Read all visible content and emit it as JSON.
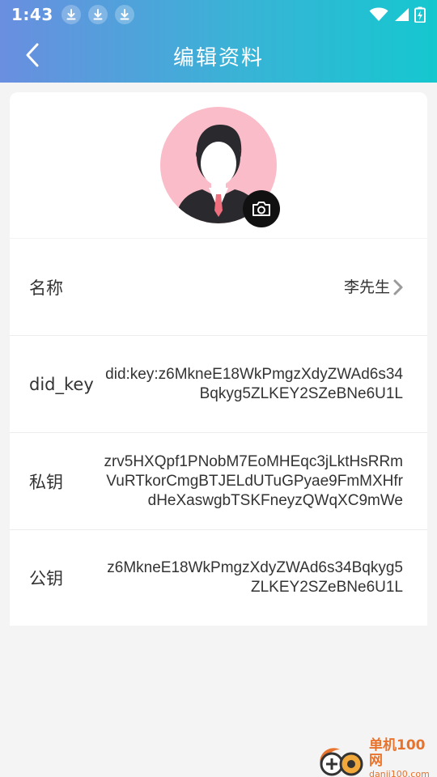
{
  "status_bar": {
    "time": "1:43",
    "download_icons": [
      "download-icon",
      "download-icon",
      "download-icon"
    ],
    "system_icons": [
      "wifi-icon",
      "signal-icon",
      "battery-charging-icon"
    ]
  },
  "header": {
    "title": "编辑资料",
    "back_icon": "chevron-left-icon"
  },
  "profile": {
    "avatar_icon": "person-avatar-icon",
    "camera_icon": "camera-icon"
  },
  "fields": [
    {
      "label": "名称",
      "value": "李先生",
      "has_arrow": true
    },
    {
      "label": "did_key",
      "value": "did:key:z6MkneE18WkPmgzXdyZWAd6s34Bqkyg5ZLKEY2SZeBNe6U1L"
    },
    {
      "label": "私钥",
      "value": "zrv5HXQpf1PNobM7EoMHEqc3jLktHsRRmVuRTkorCmgBTJELdUTuGPyae9FmMXHfrdHeXaswgbTSKFneyzQWqXC9mWe"
    },
    {
      "label": "公钥",
      "value": "z6MkneE18WkPmgzXdyZWAd6s34Bqkyg5ZLKEY2SZeBNe6U1L"
    }
  ],
  "watermark": {
    "brand": "单机100网",
    "url": "danji100.com"
  },
  "colors": {
    "header_gradient_start": "#6a8ee0",
    "header_gradient_end": "#15c7cf",
    "avatar_bg": "#fbbcc9",
    "watermark": "#e8732c"
  }
}
